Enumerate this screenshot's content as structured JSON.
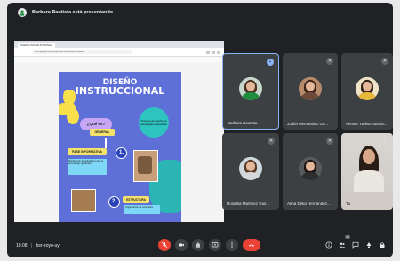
{
  "window": {
    "presenting_text": "Barbara Bautista está presentando"
  },
  "browser": {
    "tab_label": "DISEÑO INSTRUCCIONAL",
    "url": "docs.google.com/presentation/d/1eRk8nfXV8a/edit"
  },
  "poster": {
    "title_line1": "DISEÑO",
    "title_line2": "INSTRUCCIONAL",
    "question_badge": "¿Qué es?",
    "question_bubble": "Proceso de diseño de estrategias educativas",
    "pill_1": "GENERAL",
    "pill_2": "FASE INFORMATIVA",
    "step_1": "1.",
    "step_2": "2.",
    "textblock_1": "Planificación de actividades para el aprendizaje significativo",
    "pill_3": "ESTRUCTURA",
    "textblock_2": "Organización de contenidos",
    "colors": {
      "background": "#5f6fd8",
      "accent_yellow": "#f5e26b",
      "accent_teal": "#2ec4c0",
      "accent_lilac": "#c7a7f5"
    }
  },
  "participants": [
    {
      "name": "Barbara Bautista",
      "active": true,
      "mic": "speaking-icon"
    },
    {
      "name": "Judith Hernandez Go...",
      "active": false,
      "mic": "mic-off-icon"
    },
    {
      "name": "Nieves Yadira Austria...",
      "active": false,
      "mic": "mic-off-icon"
    },
    {
      "name": "Rosalba Martinez Guil...",
      "active": false,
      "mic": "mic-off-icon"
    },
    {
      "name": "Alma Delia Hernandez...",
      "active": false,
      "mic": "mic-off-icon"
    },
    {
      "name": "Tú",
      "active": false,
      "mic": "more-options-icon"
    }
  ],
  "bottombar": {
    "time": "18:08",
    "separator": "|",
    "meeting_code": "bsr-zoyo-uyi",
    "participant_count": "12"
  }
}
